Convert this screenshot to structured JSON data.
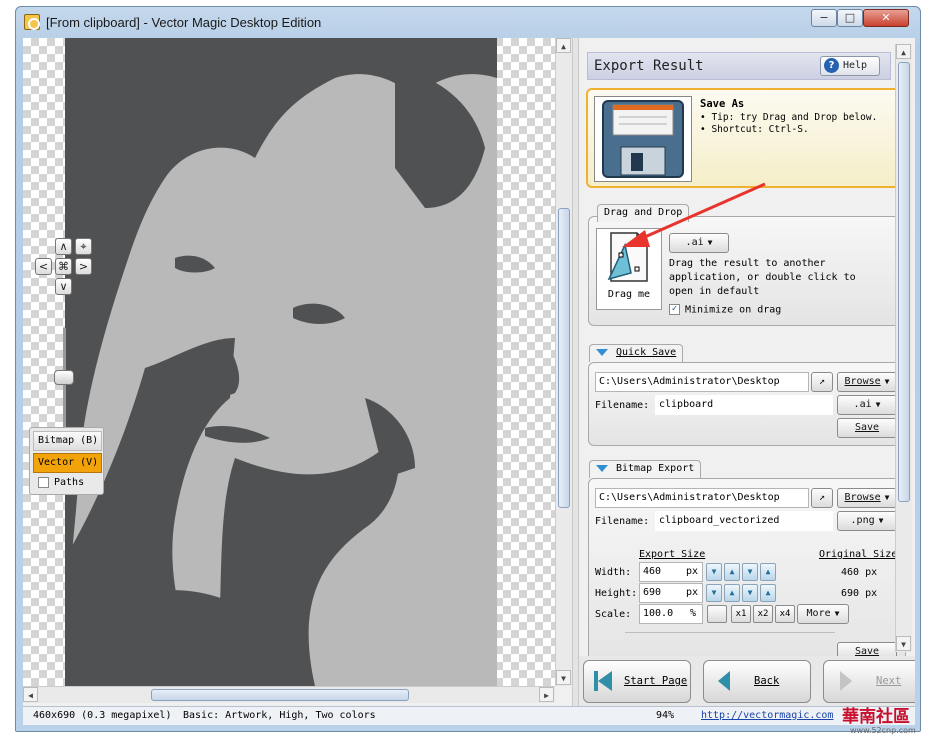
{
  "window": {
    "title": "[From clipboard] - Vector Magic Desktop Edition"
  },
  "titlebar": {
    "min": "−",
    "max": "□",
    "close": "✕"
  },
  "nav": {
    "up": "∧",
    "down": "∨",
    "left": "<",
    "right": ">",
    "fit": "⌖",
    "center": "⌘"
  },
  "modes": {
    "bitmap": "Bitmap (B)",
    "vector": "Vector (V)",
    "paths": "Paths"
  },
  "export": {
    "title": "Export Result",
    "help_label": "Help",
    "save_as": {
      "title": "Save As",
      "tips": [
        "Tip: try Drag and Drop below.",
        "Shortcut: Ctrl-S."
      ]
    },
    "drag_drop": {
      "label": "Drag and Drop",
      "format": ".ai",
      "drag_me": "Drag me",
      "description": "Drag the result to another application, or double click to open in default",
      "minimize_label": "Minimize on drag",
      "minimize_checked": "✓"
    },
    "quick_save": {
      "label": "Quick Save",
      "path": "C:\\Users\\Administrator\\Desktop",
      "browse": "Browse",
      "filename_label": "Filename:",
      "filename": "clipboard",
      "format": ".ai",
      "save": "Save"
    },
    "bitmap_export": {
      "label": "Bitmap Export",
      "path": "C:\\Users\\Administrator\\Desktop",
      "browse": "Browse",
      "filename_label": "Filename:",
      "filename": "clipboard_vectorized",
      "format": ".png",
      "export_size": "Export Size",
      "original_size": "Original Size",
      "width_label": "Width:",
      "width": "460",
      "height_label": "Height:",
      "height": "690",
      "unit": "px",
      "scale_label": "Scale:",
      "scale": "100.0",
      "scale_unit": "%",
      "orig_width": "460 px",
      "orig_height": "690 px",
      "x1": "x1",
      "x2": "x2",
      "x4": "x4",
      "more": "More",
      "save": "Save"
    }
  },
  "bottom_nav": {
    "start": "Start Page",
    "back": "Back",
    "next": "Next"
  },
  "status": {
    "dims": "460x690 (0.3 megapixel)",
    "mode": "Basic: Artwork, High, Two colors",
    "zoom": "94%",
    "url": "http://vectormagic.com"
  },
  "watermark": {
    "brand": "華南社區",
    "site": "www.52cnp.com"
  },
  "colors": {
    "accent_orange": "#f2a30a",
    "art_dark": "#4f5152",
    "art_light": "#b9b9b9",
    "arrow_red": "#e8342c"
  }
}
